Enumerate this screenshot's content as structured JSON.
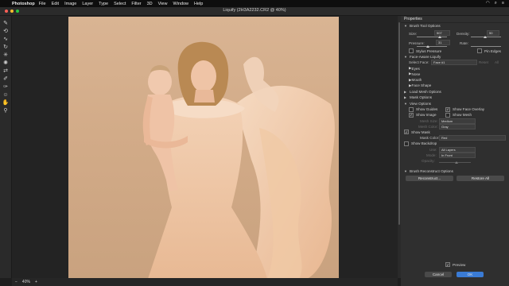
{
  "menubar": {
    "app_name": "Photoshop",
    "items": [
      "File",
      "Edit",
      "Image",
      "Layer",
      "Type",
      "Select",
      "Filter",
      "3D",
      "View",
      "Window",
      "Help"
    ]
  },
  "window": {
    "title": "Liquify (2H3A2232.CR2 @ 40%)"
  },
  "status": {
    "zoom": "40%"
  },
  "panel": {
    "header": "Properties",
    "brush_tool_options": {
      "label": "Brush Tool Options",
      "size_label": "Size:",
      "size_value": "507",
      "density_label": "Density:",
      "density_value": "50",
      "pressure_label": "Pressure:",
      "pressure_value": "31",
      "rate_label": "Rate:",
      "stylus_pressure": "Stylus Pressure",
      "pin_edges": "Pin Edges"
    },
    "face_aware": {
      "label": "Face-Aware Liquify",
      "select_face_label": "Select Face:",
      "select_face_value": "Face #1",
      "reset_label": "Reset",
      "all_label": "All",
      "items": [
        "Eyes",
        "Nose",
        "Mouth",
        "Face Shape"
      ]
    },
    "load_mesh_options": "Load Mesh Options",
    "mask_options": "Mask Options",
    "view_options": {
      "label": "View Options",
      "show_guides": "Show Guides",
      "show_face_overlay": "Show Face Overlay",
      "show_image": "Show Image",
      "show_mesh": "Show Mesh",
      "mesh_size_label": "Mesh Size:",
      "mesh_size_value": "Medium",
      "mesh_color_label": "Mesh Color:",
      "mesh_color_value": "Gray"
    },
    "show_mask": {
      "label": "Show Mask",
      "mask_color_label": "Mask Color:",
      "mask_color_value": "Red"
    },
    "show_backdrop": {
      "label": "Show Backdrop",
      "use_label": "Use:",
      "use_value": "All Layers",
      "mode_label": "Mode:",
      "mode_value": "In Front",
      "opacity_label": "Opacity:"
    },
    "brush_reconstruct": {
      "label": "Brush Reconstruct Options",
      "reconstruct": "Reconstruct...",
      "restore_all": "Restore All"
    },
    "preview": "Preview",
    "cancel": "Cancel",
    "ok": "OK"
  },
  "colors": {
    "accent": "#3a7bd5",
    "panel_bg": "#2f2f2f",
    "backdrop": "#d4ad8b"
  }
}
